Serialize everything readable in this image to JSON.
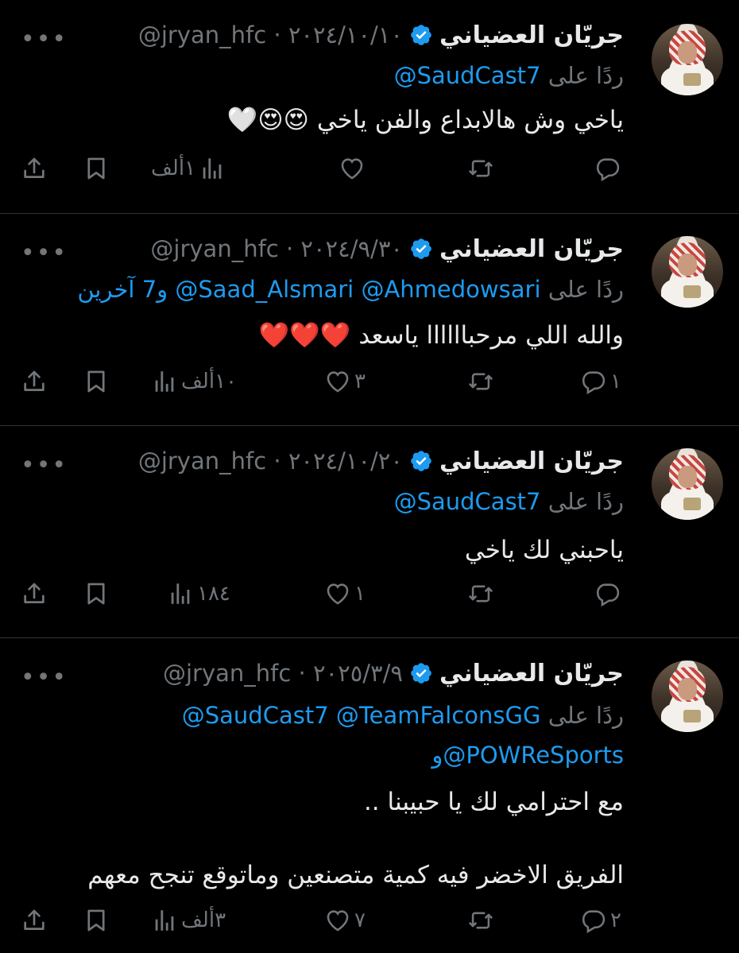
{
  "tweets": [
    {
      "name": "جريّان العضياني",
      "handle_date": "@jryan_hfc · ٢٠٢٤/١٠/١٠",
      "reply_label": "ردًا على",
      "mentions": "@SaudCast7",
      "others": "",
      "body": "ياخي وش هالابداع والفن ياخي 😍😍🤍",
      "counts": {
        "reply": "",
        "retweet": "",
        "like": "",
        "views": "١ألف"
      }
    },
    {
      "name": "جريّان العضياني",
      "handle_date": "@jryan_hfc · ٢٠٢٤/٩/٣٠",
      "reply_label": "ردًا على",
      "mentions": "@Saad_Alsmari @Ahmedowsari",
      "others": "و7 آخرين",
      "body": "والله اللي مرحباااااا ياسعد ❤️❤️❤️",
      "counts": {
        "reply": "١",
        "retweet": "",
        "like": "٣",
        "views": "١٠ألف"
      }
    },
    {
      "name": "جريّان العضياني",
      "handle_date": "@jryan_hfc · ٢٠٢٤/١٠/٢٠",
      "reply_label": "ردًا على",
      "mentions": "@SaudCast7",
      "others": "",
      "body": "ياحبني لك ياخي",
      "counts": {
        "reply": "",
        "retweet": "",
        "like": "١",
        "views": "١٨٤"
      }
    },
    {
      "name": "جريّان العضياني",
      "handle_date": "@jryan_hfc · ٢٠٢٥/٣/٩",
      "reply_label": "ردًا على",
      "mentions": "@SaudCast7 @TeamFalconsGG",
      "mentions2": "و@POWReSports",
      "others": "",
      "body": "مع احترامي لك يا حبيبنا ..",
      "body2": "الفريق الاخضر فيه كمية متصنعين وماتوقع تنجح معهم",
      "counts": {
        "reply": "٢",
        "retweet": "",
        "like": "٧",
        "views": "٣ألف"
      }
    }
  ],
  "colors": {
    "background": "#000000",
    "text": "#e7e9ea",
    "muted": "#71767b",
    "link": "#1d9bf0",
    "divider": "#2f3336"
  },
  "icons": [
    "verified-badge-icon",
    "more-icon",
    "reply-icon",
    "retweet-icon",
    "like-icon",
    "views-icon",
    "bookmark-icon",
    "share-icon"
  ]
}
